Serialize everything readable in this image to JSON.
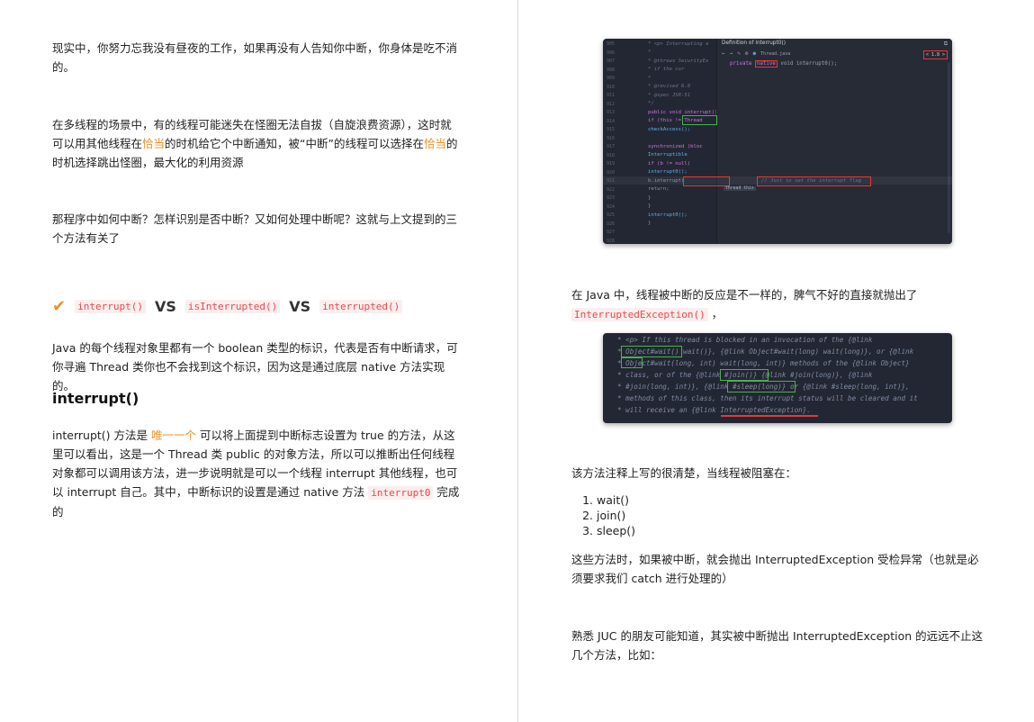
{
  "left": {
    "para1": "现实中，你努力忘我没有昼夜的工作，如果再没有人告知你中断，你身体是吃不消的。",
    "para2": {
      "a": "在多线程的场景中，有的线程可能迷失在怪圈无法自拔（自旋浪费资源），这时就可以用其他线程在",
      "hl1": "恰当",
      "b": "的时机给它个中断通知，被“中断”的线程可以选择在",
      "hl2": "恰当",
      "c": "的时机选择跳出怪圈，最大化的利用资源"
    },
    "para3": "那程序中如何中断？怎样识别是否中断？又如何处理中断呢？这就与上文提到的三个方法有关了",
    "heading_vs": {
      "m1": "interrupt()",
      "vs": "VS",
      "m2": "isInterrupted()",
      "m3": "interrupted()"
    },
    "para4": "Java 的每个线程对象里都有一个 boolean 类型的标识，代表是否有中断请求，可你寻遍 Thread 类你也不会找到这个标识，因为这是通过底层 native 方法实现的。",
    "heading_interrupt": "interrupt()",
    "para5": {
      "a": "interrupt() 方法是 ",
      "hl": "唯一一个",
      "b": " 可以将上面提到中断标志设置为 true 的方法，从这里可以看出，这是一个 Thread 类 public 的对象方法，所以可以推断出任何线程对象都可以调用该方法，进一步说明就是可以一个线程 interrupt 其他线程，也可以 interrupt 自己。其中，中断标识的设置是通过 native 方法 ",
      "code": "interrupt0",
      "c": " 完成的"
    }
  },
  "right": {
    "ide": {
      "line_numbers": [
        "905",
        "906",
        "907",
        "908",
        "909",
        "910",
        "911",
        "912",
        "913",
        "914",
        "915",
        "916",
        "917",
        "918",
        "919",
        "920",
        "921",
        "922",
        "923",
        "924",
        "925",
        "926",
        "927",
        "928"
      ],
      "popup_title": "Definition of interrupt0()",
      "popup_file": "Thread.java",
      "popup_jdk": "< 1.8 >",
      "popup_code_a": "private ",
      "popup_code_native": "native",
      "popup_code_b": " void interrupt0();",
      "lines": [
        " * <p> Interrupting a",
        " *",
        " * @throws  SecurityEx",
        " *          if the cur",
        " *",
        " * @revised 6.0",
        " * @spec JSR-51",
        " */",
        "public void interrupt()",
        "    if (this != Thread",
        "        checkAccess();",
        "",
        "    synchronized (bloc",
        "        Interruptible",
        "        if (b != null)",
        "            interrupt0();",
        "            b.interrupt(",
        "            return;",
        "        }",
        "    }",
        "    interrupt0();",
        "}"
      ],
      "inline_hint": "thread this",
      "comment": "// Just to set the interrupt flag"
    },
    "para1": {
      "a": "在 Java 中，线程被中断的反应是不一样的，脾气不好的直接就抛出了 ",
      "code": "InterruptedException()",
      "b": " ，"
    },
    "javadoc": [
      "* <p> If this thread is blocked in an invocation of the {@link",
      "* Object#wait() wait()}, {@link Object#wait(long) wait(long)}, or {@link",
      "* Object#wait(long, int) wait(long, int)} methods of the {@link Object}",
      "* class, or of the {@link #join()} {@link #join(long)}, {@link",
      "* #join(long, int)}, {@link #sleep(long)} or {@link #sleep(long, int)},",
      "* methods of this class, then its interrupt status will be cleared and it",
      "* will receive an {@link InterruptedException}."
    ],
    "para2": "该方法注释上写的很清楚，当线程被阻塞在：",
    "list": [
      "wait()",
      "join()",
      "sleep()"
    ],
    "para3": "这些方法时，如果被中断，就会抛出 InterruptedException 受检异常（也就是必须要求我们 catch 进行处理的）",
    "para4": "熟悉 JUC 的朋友可能知道，其实被中断抛出 InterruptedException 的远远不止这几个方法，比如："
  }
}
